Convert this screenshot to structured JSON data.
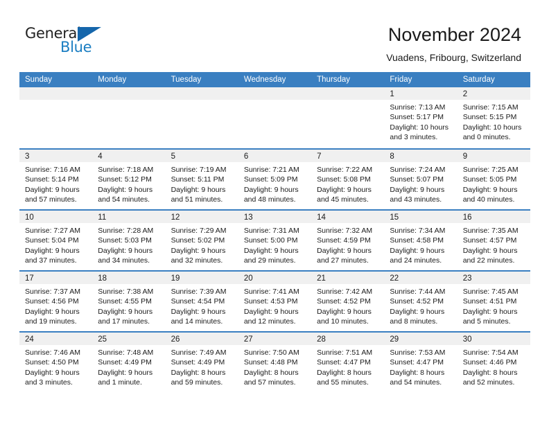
{
  "brand": {
    "name_part1": "General",
    "name_part2": "Blue",
    "accent_color": "#1566ab",
    "blue_text_color": "#1b7ec2"
  },
  "header": {
    "month_title": "November 2024",
    "location": "Vuadens, Fribourg, Switzerland"
  },
  "calendar": {
    "header_bg": "#3a7fc1",
    "day_band_bg": "#f0f0f0",
    "weekdays": [
      "Sunday",
      "Monday",
      "Tuesday",
      "Wednesday",
      "Thursday",
      "Friday",
      "Saturday"
    ],
    "weeks": [
      [
        {
          "empty": true
        },
        {
          "empty": true
        },
        {
          "empty": true
        },
        {
          "empty": true
        },
        {
          "empty": true
        },
        {
          "day": "1",
          "sunrise": "Sunrise: 7:13 AM",
          "sunset": "Sunset: 5:17 PM",
          "daylight_line1": "Daylight: 10 hours",
          "daylight_line2": "and 3 minutes."
        },
        {
          "day": "2",
          "sunrise": "Sunrise: 7:15 AM",
          "sunset": "Sunset: 5:15 PM",
          "daylight_line1": "Daylight: 10 hours",
          "daylight_line2": "and 0 minutes."
        }
      ],
      [
        {
          "day": "3",
          "sunrise": "Sunrise: 7:16 AM",
          "sunset": "Sunset: 5:14 PM",
          "daylight_line1": "Daylight: 9 hours",
          "daylight_line2": "and 57 minutes."
        },
        {
          "day": "4",
          "sunrise": "Sunrise: 7:18 AM",
          "sunset": "Sunset: 5:12 PM",
          "daylight_line1": "Daylight: 9 hours",
          "daylight_line2": "and 54 minutes."
        },
        {
          "day": "5",
          "sunrise": "Sunrise: 7:19 AM",
          "sunset": "Sunset: 5:11 PM",
          "daylight_line1": "Daylight: 9 hours",
          "daylight_line2": "and 51 minutes."
        },
        {
          "day": "6",
          "sunrise": "Sunrise: 7:21 AM",
          "sunset": "Sunset: 5:09 PM",
          "daylight_line1": "Daylight: 9 hours",
          "daylight_line2": "and 48 minutes."
        },
        {
          "day": "7",
          "sunrise": "Sunrise: 7:22 AM",
          "sunset": "Sunset: 5:08 PM",
          "daylight_line1": "Daylight: 9 hours",
          "daylight_line2": "and 45 minutes."
        },
        {
          "day": "8",
          "sunrise": "Sunrise: 7:24 AM",
          "sunset": "Sunset: 5:07 PM",
          "daylight_line1": "Daylight: 9 hours",
          "daylight_line2": "and 43 minutes."
        },
        {
          "day": "9",
          "sunrise": "Sunrise: 7:25 AM",
          "sunset": "Sunset: 5:05 PM",
          "daylight_line1": "Daylight: 9 hours",
          "daylight_line2": "and 40 minutes."
        }
      ],
      [
        {
          "day": "10",
          "sunrise": "Sunrise: 7:27 AM",
          "sunset": "Sunset: 5:04 PM",
          "daylight_line1": "Daylight: 9 hours",
          "daylight_line2": "and 37 minutes."
        },
        {
          "day": "11",
          "sunrise": "Sunrise: 7:28 AM",
          "sunset": "Sunset: 5:03 PM",
          "daylight_line1": "Daylight: 9 hours",
          "daylight_line2": "and 34 minutes."
        },
        {
          "day": "12",
          "sunrise": "Sunrise: 7:29 AM",
          "sunset": "Sunset: 5:02 PM",
          "daylight_line1": "Daylight: 9 hours",
          "daylight_line2": "and 32 minutes."
        },
        {
          "day": "13",
          "sunrise": "Sunrise: 7:31 AM",
          "sunset": "Sunset: 5:00 PM",
          "daylight_line1": "Daylight: 9 hours",
          "daylight_line2": "and 29 minutes."
        },
        {
          "day": "14",
          "sunrise": "Sunrise: 7:32 AM",
          "sunset": "Sunset: 4:59 PM",
          "daylight_line1": "Daylight: 9 hours",
          "daylight_line2": "and 27 minutes."
        },
        {
          "day": "15",
          "sunrise": "Sunrise: 7:34 AM",
          "sunset": "Sunset: 4:58 PM",
          "daylight_line1": "Daylight: 9 hours",
          "daylight_line2": "and 24 minutes."
        },
        {
          "day": "16",
          "sunrise": "Sunrise: 7:35 AM",
          "sunset": "Sunset: 4:57 PM",
          "daylight_line1": "Daylight: 9 hours",
          "daylight_line2": "and 22 minutes."
        }
      ],
      [
        {
          "day": "17",
          "sunrise": "Sunrise: 7:37 AM",
          "sunset": "Sunset: 4:56 PM",
          "daylight_line1": "Daylight: 9 hours",
          "daylight_line2": "and 19 minutes."
        },
        {
          "day": "18",
          "sunrise": "Sunrise: 7:38 AM",
          "sunset": "Sunset: 4:55 PM",
          "daylight_line1": "Daylight: 9 hours",
          "daylight_line2": "and 17 minutes."
        },
        {
          "day": "19",
          "sunrise": "Sunrise: 7:39 AM",
          "sunset": "Sunset: 4:54 PM",
          "daylight_line1": "Daylight: 9 hours",
          "daylight_line2": "and 14 minutes."
        },
        {
          "day": "20",
          "sunrise": "Sunrise: 7:41 AM",
          "sunset": "Sunset: 4:53 PM",
          "daylight_line1": "Daylight: 9 hours",
          "daylight_line2": "and 12 minutes."
        },
        {
          "day": "21",
          "sunrise": "Sunrise: 7:42 AM",
          "sunset": "Sunset: 4:52 PM",
          "daylight_line1": "Daylight: 9 hours",
          "daylight_line2": "and 10 minutes."
        },
        {
          "day": "22",
          "sunrise": "Sunrise: 7:44 AM",
          "sunset": "Sunset: 4:52 PM",
          "daylight_line1": "Daylight: 9 hours",
          "daylight_line2": "and 8 minutes."
        },
        {
          "day": "23",
          "sunrise": "Sunrise: 7:45 AM",
          "sunset": "Sunset: 4:51 PM",
          "daylight_line1": "Daylight: 9 hours",
          "daylight_line2": "and 5 minutes."
        }
      ],
      [
        {
          "day": "24",
          "sunrise": "Sunrise: 7:46 AM",
          "sunset": "Sunset: 4:50 PM",
          "daylight_line1": "Daylight: 9 hours",
          "daylight_line2": "and 3 minutes."
        },
        {
          "day": "25",
          "sunrise": "Sunrise: 7:48 AM",
          "sunset": "Sunset: 4:49 PM",
          "daylight_line1": "Daylight: 9 hours",
          "daylight_line2": "and 1 minute."
        },
        {
          "day": "26",
          "sunrise": "Sunrise: 7:49 AM",
          "sunset": "Sunset: 4:49 PM",
          "daylight_line1": "Daylight: 8 hours",
          "daylight_line2": "and 59 minutes."
        },
        {
          "day": "27",
          "sunrise": "Sunrise: 7:50 AM",
          "sunset": "Sunset: 4:48 PM",
          "daylight_line1": "Daylight: 8 hours",
          "daylight_line2": "and 57 minutes."
        },
        {
          "day": "28",
          "sunrise": "Sunrise: 7:51 AM",
          "sunset": "Sunset: 4:47 PM",
          "daylight_line1": "Daylight: 8 hours",
          "daylight_line2": "and 55 minutes."
        },
        {
          "day": "29",
          "sunrise": "Sunrise: 7:53 AM",
          "sunset": "Sunset: 4:47 PM",
          "daylight_line1": "Daylight: 8 hours",
          "daylight_line2": "and 54 minutes."
        },
        {
          "day": "30",
          "sunrise": "Sunrise: 7:54 AM",
          "sunset": "Sunset: 4:46 PM",
          "daylight_line1": "Daylight: 8 hours",
          "daylight_line2": "and 52 minutes."
        }
      ]
    ]
  }
}
